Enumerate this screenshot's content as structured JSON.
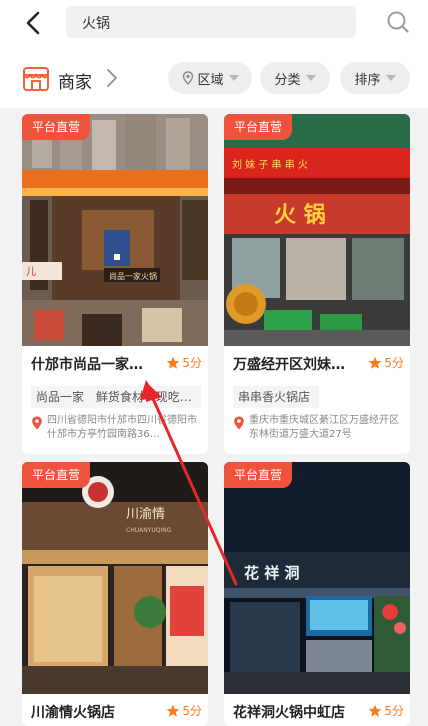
{
  "search": {
    "query": "火锅"
  },
  "section": {
    "title": "商家",
    "filters": [
      {
        "label": "区域",
        "icon": "location-pin-icon"
      },
      {
        "label": "分类"
      },
      {
        "label": "排序"
      }
    ]
  },
  "colors": {
    "accent": "#f0533b",
    "score": "#ff7a1a"
  },
  "cards": [
    {
      "badge": "平台直营",
      "name": "什邡市尚品一家…",
      "score": "5分",
      "tags": [
        "尚品一家",
        "鲜货食材",
        "现吃…"
      ],
      "address": "四川省德阳市什邡市四川省德阳市什邡市方亭竹园南路36…"
    },
    {
      "badge": "平台直营",
      "name": "万盛经开区刘妹…",
      "score": "5分",
      "tags": [
        "串串香火锅店"
      ],
      "address": "重庆市重庆城区綦江区万盛经开区东林街道万盛大道27号"
    },
    {
      "badge": "平台直营",
      "name": "川渝情火锅店",
      "score": "5分",
      "storefront": "川渝情",
      "storefront_sub": "CHUANYUQING"
    },
    {
      "badge": "平台直营",
      "name": "花祥洞火锅中虹店",
      "score": "5分",
      "storefront": "花 祥 洞"
    }
  ],
  "photo1": {
    "sign": "尚品一家火锅",
    "side": "儿"
  },
  "photo2": {
    "sign": "刘 妹 子 串 串 火",
    "big": "火 锅"
  }
}
